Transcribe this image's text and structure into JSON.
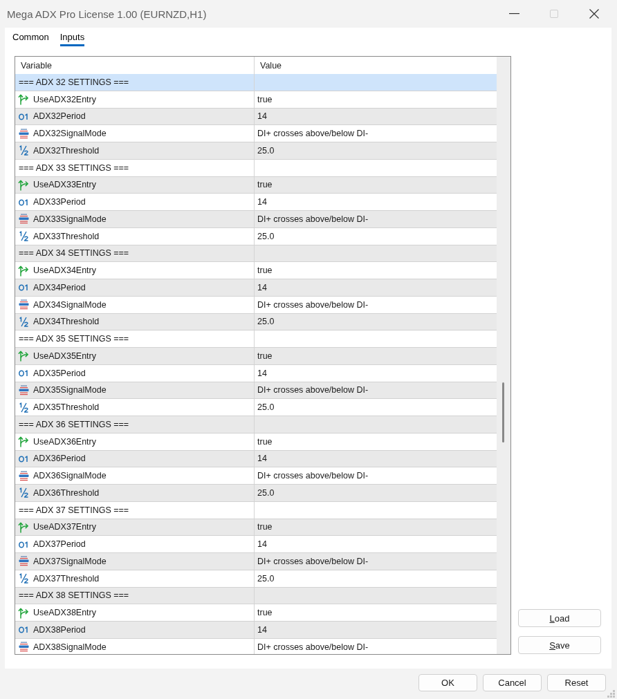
{
  "window": {
    "title": "Mega ADX Pro License 1.00 (EURNZD,H1)",
    "maximize_disabled": true
  },
  "tabs": [
    {
      "label": "Common",
      "selected": false
    },
    {
      "label": "Inputs",
      "selected": true
    }
  ],
  "table": {
    "columns": [
      "Variable",
      "Value"
    ],
    "rows": [
      {
        "kind": "separator",
        "variable": "=== ADX 32 SETTINGS ===",
        "selected": true
      },
      {
        "kind": "bool",
        "variable": "UseADX32Entry",
        "value": "true",
        "selected": false
      },
      {
        "kind": "int",
        "variable": "ADX32Period",
        "value": "14",
        "selected": false
      },
      {
        "kind": "enum",
        "variable": "ADX32SignalMode",
        "value": "DI+ crosses above/below DI-",
        "selected": false
      },
      {
        "kind": "double",
        "variable": "ADX32Threshold",
        "value": "25.0",
        "selected": false
      },
      {
        "kind": "separator",
        "variable": "=== ADX 33 SETTINGS ===",
        "selected": false
      },
      {
        "kind": "bool",
        "variable": "UseADX33Entry",
        "value": "true",
        "selected": false
      },
      {
        "kind": "int",
        "variable": "ADX33Period",
        "value": "14",
        "selected": false
      },
      {
        "kind": "enum",
        "variable": "ADX33SignalMode",
        "value": "DI+ crosses above/below DI-",
        "selected": false
      },
      {
        "kind": "double",
        "variable": "ADX33Threshold",
        "value": "25.0",
        "selected": false
      },
      {
        "kind": "separator",
        "variable": "=== ADX 34 SETTINGS ===",
        "selected": false
      },
      {
        "kind": "bool",
        "variable": "UseADX34Entry",
        "value": "true",
        "selected": false
      },
      {
        "kind": "int",
        "variable": "ADX34Period",
        "value": "14",
        "selected": false
      },
      {
        "kind": "enum",
        "variable": "ADX34SignalMode",
        "value": "DI+ crosses above/below DI-",
        "selected": false
      },
      {
        "kind": "double",
        "variable": "ADX34Threshold",
        "value": "25.0",
        "selected": false
      },
      {
        "kind": "separator",
        "variable": "=== ADX 35 SETTINGS ===",
        "selected": false
      },
      {
        "kind": "bool",
        "variable": "UseADX35Entry",
        "value": "true",
        "selected": false
      },
      {
        "kind": "int",
        "variable": "ADX35Period",
        "value": "14",
        "selected": false
      },
      {
        "kind": "enum",
        "variable": "ADX35SignalMode",
        "value": "DI+ crosses above/below DI-",
        "selected": false
      },
      {
        "kind": "double",
        "variable": "ADX35Threshold",
        "value": "25.0",
        "selected": false
      },
      {
        "kind": "separator",
        "variable": "=== ADX 36 SETTINGS ===",
        "selected": false
      },
      {
        "kind": "bool",
        "variable": "UseADX36Entry",
        "value": "true",
        "selected": false
      },
      {
        "kind": "int",
        "variable": "ADX36Period",
        "value": "14",
        "selected": false
      },
      {
        "kind": "enum",
        "variable": "ADX36SignalMode",
        "value": "DI+ crosses above/below DI-",
        "selected": false
      },
      {
        "kind": "double",
        "variable": "ADX36Threshold",
        "value": "25.0",
        "selected": false
      },
      {
        "kind": "separator",
        "variable": "=== ADX 37 SETTINGS ===",
        "selected": false
      },
      {
        "kind": "bool",
        "variable": "UseADX37Entry",
        "value": "true",
        "selected": false
      },
      {
        "kind": "int",
        "variable": "ADX37Period",
        "value": "14",
        "selected": false
      },
      {
        "kind": "enum",
        "variable": "ADX37SignalMode",
        "value": "DI+ crosses above/below DI-",
        "selected": false
      },
      {
        "kind": "double",
        "variable": "ADX37Threshold",
        "value": "25.0",
        "selected": false
      },
      {
        "kind": "separator",
        "variable": "=== ADX 38 SETTINGS ===",
        "selected": false
      },
      {
        "kind": "bool",
        "variable": "UseADX38Entry",
        "value": "true",
        "selected": false
      },
      {
        "kind": "int",
        "variable": "ADX38Period",
        "value": "14",
        "selected": false
      },
      {
        "kind": "enum",
        "variable": "ADX38SignalMode",
        "value": "DI+ crosses above/below DI-",
        "selected": false
      }
    ]
  },
  "side_buttons": [
    {
      "label": "Load",
      "mnemonic": true
    },
    {
      "label": "Save",
      "mnemonic": true
    }
  ],
  "footer_buttons": [
    {
      "label": "OK"
    },
    {
      "label": "Cancel"
    },
    {
      "label": "Reset"
    }
  ]
}
